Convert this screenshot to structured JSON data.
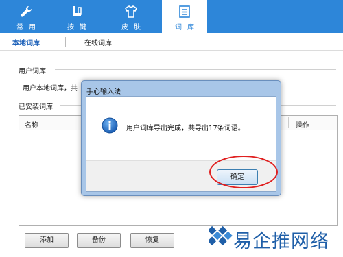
{
  "top_tabs": [
    {
      "label": "常用",
      "icon": "wrench-icon"
    },
    {
      "label": "按键",
      "icon": "key-icon"
    },
    {
      "label": "皮肤",
      "icon": "tshirt-icon"
    },
    {
      "label": "词库",
      "icon": "document-icon"
    }
  ],
  "active_top_tab": "词库",
  "sub_tabs": [
    "本地词库",
    "在线词库"
  ],
  "user_dict": {
    "section_label": "用户词库",
    "text": "用户本地词库，共"
  },
  "installed_dict": {
    "section_label": "已安装词库",
    "columns": [
      "名称",
      "操作"
    ]
  },
  "buttons": {
    "add": "添加",
    "backup": "备份",
    "restore": "恢复"
  },
  "dialog": {
    "title": "手心输入法",
    "message": "用户词库导出完成，共导出17条词语。",
    "ok_label": "确定",
    "icon": "info-icon"
  },
  "watermark": {
    "text": "易企推网络"
  },
  "colors": {
    "topbar": "#2d86d9",
    "dialog_frame": "#a8c6e8",
    "highlight_circle": "#e02020"
  }
}
